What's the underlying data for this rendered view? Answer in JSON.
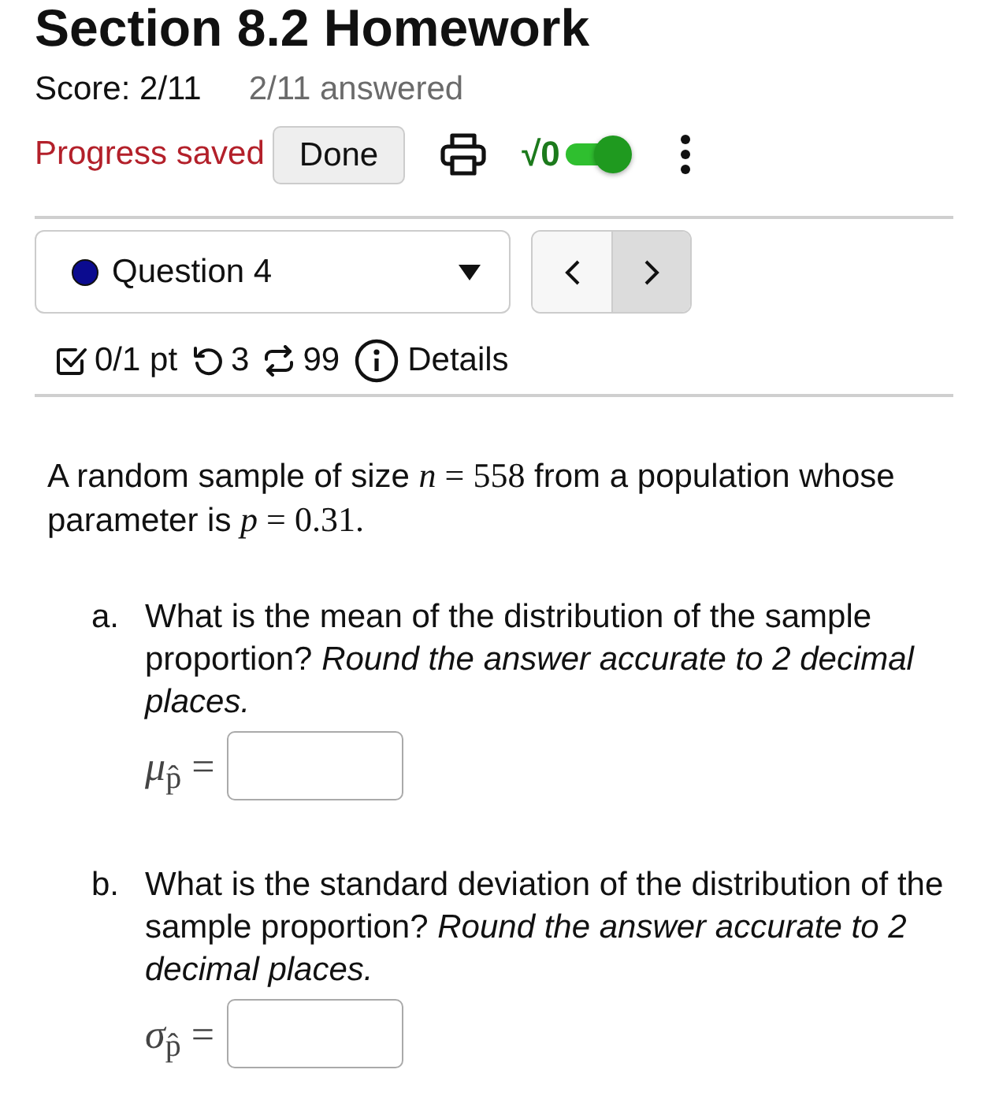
{
  "header": {
    "title": "Section 8.2 Homework",
    "score": "Score: 2/11",
    "answered": "2/11 answered",
    "status": "Progress saved",
    "done_button": "Done",
    "math_toggle": {
      "label": "√0",
      "on": true
    }
  },
  "question_select": {
    "label": "Question 4"
  },
  "nav_buttons": [
    {
      "kind": "previous",
      "highlighted": false
    },
    {
      "kind": "next",
      "highlighted": true
    }
  ],
  "meta": {
    "points": "0/1 pt",
    "retries": "3",
    "attempts": "99",
    "details": "Details"
  },
  "intro": [
    {
      "kind": "text",
      "text": "A random sample of size "
    },
    {
      "kind": "math",
      "text": "*n* = 558"
    },
    {
      "kind": "text",
      "text": " from a population whose parameter is "
    },
    {
      "kind": "math",
      "text": "*p* = 0.31."
    }
  ],
  "parts": [
    {
      "marker": "a.",
      "question": "What is the mean of the distribution of the sample proportion? *Round the answer accurate to 2 decimal places.*",
      "formula": "*μ*$_{p̂}$ ="
    },
    {
      "marker": "b.",
      "question": "What is the standard deviation of the distribution of the sample proportion? *Round the answer accurate to 2 decimal places.*",
      "formula": "*σ*$_{p̂}$ ="
    }
  ]
}
